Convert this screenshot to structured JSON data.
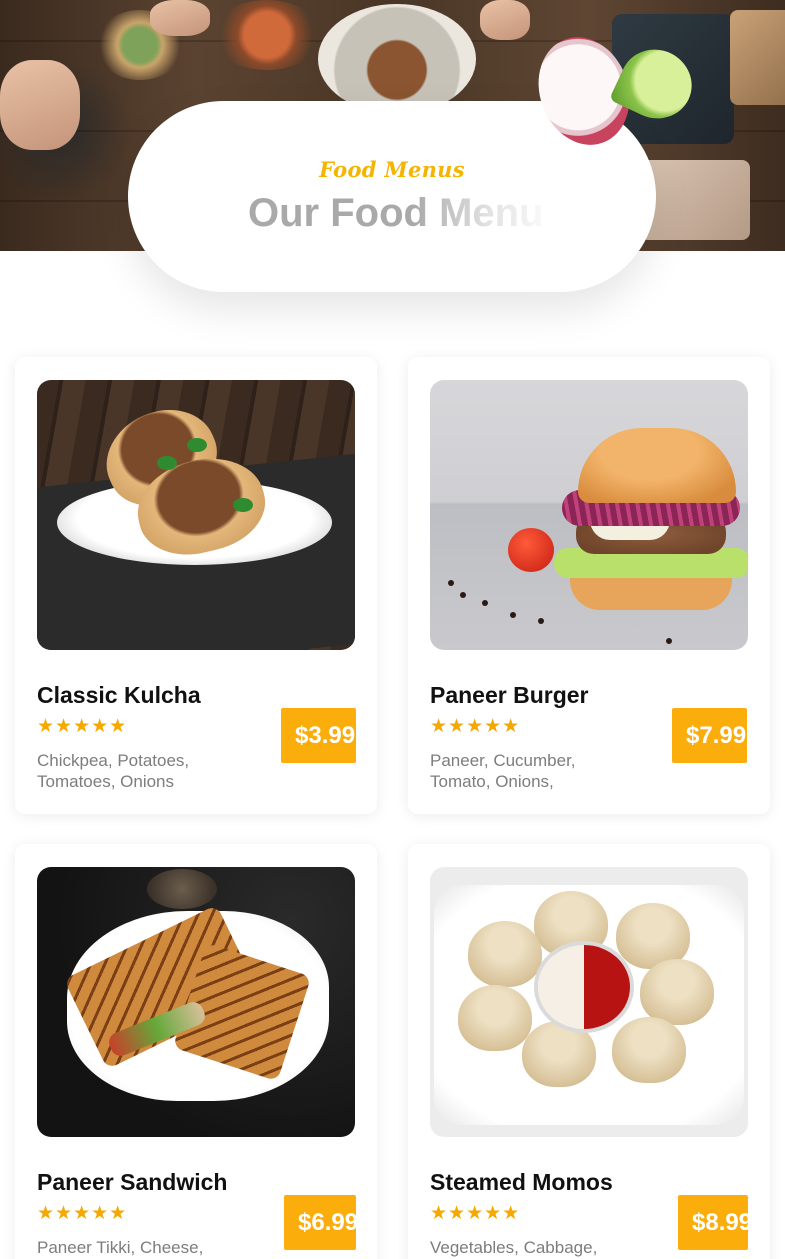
{
  "hero": {
    "subtitle": "Food Menus",
    "heading": "Our Food Menu"
  },
  "menu": {
    "items": [
      {
        "name": "Classic Kulcha",
        "rating": 5,
        "stars": "★★★★★",
        "description": "Chickpea, Potatoes, Tomatoes, Onions",
        "price": "$3.99",
        "image": "kulcha-photo"
      },
      {
        "name": "Paneer Burger",
        "rating": 5,
        "stars": "★★★★★",
        "description": "Paneer, Cucumber, Tomato, Onions,",
        "price": "$7.99",
        "image": "burger-photo"
      },
      {
        "name": "Paneer Sandwich",
        "rating": 5,
        "stars": "★★★★★",
        "description": "Paneer Tikki, Cheese, Onion,",
        "price": "$6.99",
        "image": "sandwich-photo"
      },
      {
        "name": "Steamed Momos",
        "rating": 5,
        "stars": "★★★★★",
        "description": "Vegetables, Cabbage,",
        "price": "$8.99",
        "image": "momos-photo"
      }
    ]
  },
  "colors": {
    "accent": "#fbad0c",
    "subtitle": "#f4b400",
    "heading": "#a9a9a9",
    "title_text": "#111111",
    "body_text": "#7d7d7d"
  }
}
